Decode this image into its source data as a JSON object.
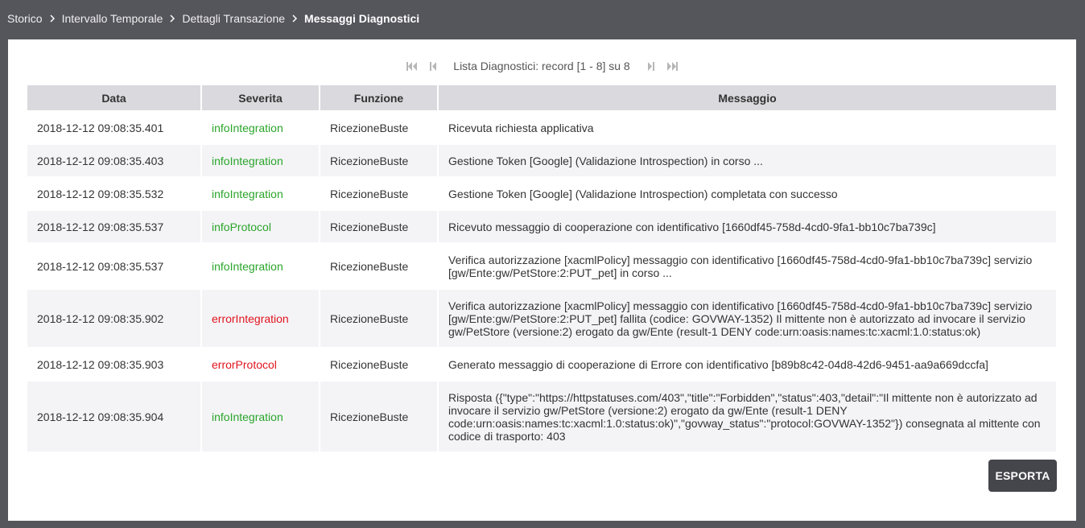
{
  "breadcrumb": {
    "items": [
      "Storico",
      "Intervallo Temporale",
      "Dettagli Transazione"
    ],
    "current": "Messaggi Diagnostici"
  },
  "pager": {
    "label": "Lista Diagnostici: record [1 - 8] su 8",
    "icons": [
      "first-page-icon",
      "previous-page-icon",
      "next-page-icon",
      "last-page-icon"
    ]
  },
  "table": {
    "headers": [
      "Data",
      "Severita",
      "Funzione",
      "Messaggio"
    ],
    "rows": [
      {
        "data": "2018-12-12 09:08:35.401",
        "severita": "infoIntegration",
        "funzione": "RicezioneBuste",
        "messaggio": "Ricevuta richiesta applicativa"
      },
      {
        "data": "2018-12-12 09:08:35.403",
        "severita": "infoIntegration",
        "funzione": "RicezioneBuste",
        "messaggio": "Gestione Token [Google] (Validazione Introspection) in corso ..."
      },
      {
        "data": "2018-12-12 09:08:35.532",
        "severita": "infoIntegration",
        "funzione": "RicezioneBuste",
        "messaggio": "Gestione Token [Google] (Validazione Introspection) completata con successo"
      },
      {
        "data": "2018-12-12 09:08:35.537",
        "severita": "infoProtocol",
        "funzione": "RicezioneBuste",
        "messaggio": "Ricevuto messaggio di cooperazione con identificativo [1660df45-758d-4cd0-9fa1-bb10c7ba739c]"
      },
      {
        "data": "2018-12-12 09:08:35.537",
        "severita": "infoIntegration",
        "funzione": "RicezioneBuste",
        "messaggio": "Verifica autorizzazione [xacmlPolicy] messaggio con identificativo [1660df45-758d-4cd0-9fa1-bb10c7ba739c] servizio [gw/Ente:gw/PetStore:2:PUT_pet] in corso ..."
      },
      {
        "data": "2018-12-12 09:08:35.902",
        "severita": "errorIntegration",
        "funzione": "RicezioneBuste",
        "messaggio": "Verifica autorizzazione [xacmlPolicy] messaggio con identificativo [1660df45-758d-4cd0-9fa1-bb10c7ba739c] servizio [gw/Ente:gw/PetStore:2:PUT_pet] fallita (codice: GOVWAY-1352) Il mittente non è autorizzato ad invocare il servizio gw/PetStore (versione:2) erogato da gw/Ente (result-1 DENY code:urn:oasis:names:tc:xacml:1.0:status:ok)"
      },
      {
        "data": "2018-12-12 09:08:35.903",
        "severita": "errorProtocol",
        "funzione": "RicezioneBuste",
        "messaggio": "Generato messaggio di cooperazione di Errore con identificativo [b89b8c42-04d8-42d6-9451-aa9a669dccfa]"
      },
      {
        "data": "2018-12-12 09:08:35.904",
        "severita": "infoIntegration",
        "funzione": "RicezioneBuste",
        "messaggio": "Risposta ({\"type\":\"https://httpstatuses.com/403\",\"title\":\"Forbidden\",\"status\":403,\"detail\":\"Il mittente non è autorizzato ad invocare il servizio gw/PetStore (versione:2) erogato da gw/Ente (result-1 DENY code:urn:oasis:names:tc:xacml:1.0:status:ok)\",\"govway_status\":\"protocol:GOVWAY-1352\"}) consegnata al mittente con codice di trasporto: 403"
      }
    ]
  },
  "actions": {
    "export_label": "ESPORTA"
  },
  "colors": {
    "background": "#55555c",
    "info": "#2aa52a",
    "error": "#e0141e",
    "header": "#d9d9de",
    "button": "#45454c"
  }
}
